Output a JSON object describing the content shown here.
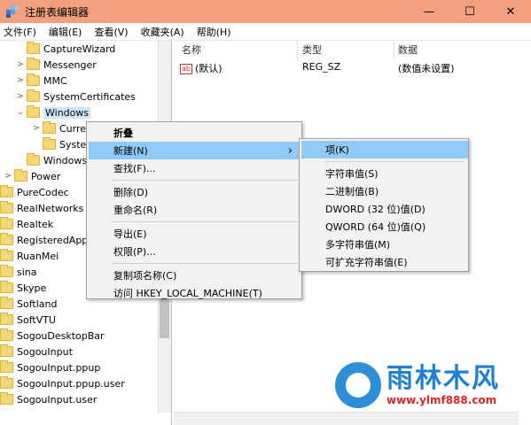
{
  "window": {
    "title": "注册表编辑器",
    "min": "—",
    "max": "☐",
    "close": "✕"
  },
  "menu": [
    "文件(F)",
    "编辑(E)",
    "查看(V)",
    "收藏夹(A)",
    "帮助(H)"
  ],
  "tree": [
    {
      "label": "CaptureWizard",
      "indent": 2,
      "expander": ""
    },
    {
      "label": "Messenger",
      "indent": 2,
      "expander": ">"
    },
    {
      "label": "MMC",
      "indent": 2,
      "expander": ">"
    },
    {
      "label": "SystemCertificates",
      "indent": 2,
      "expander": ">"
    },
    {
      "label": "Windows",
      "indent": 2,
      "expander": "v",
      "selected": true
    },
    {
      "label": "Curre",
      "indent": 3,
      "expander": ">"
    },
    {
      "label": "Syster",
      "indent": 3,
      "expander": ""
    },
    {
      "label": "Windows",
      "indent": 2,
      "expander": ""
    },
    {
      "label": "Power",
      "indent": 1,
      "expander": ">"
    },
    {
      "label": "PureCodec",
      "indent": 0,
      "expander": ""
    },
    {
      "label": "RealNetworks",
      "indent": 0,
      "expander": ""
    },
    {
      "label": "Realtek",
      "indent": 0,
      "expander": ""
    },
    {
      "label": "RegisteredAppl",
      "indent": 0,
      "expander": ""
    },
    {
      "label": "RuanMei",
      "indent": 0,
      "expander": ""
    },
    {
      "label": "sina",
      "indent": 0,
      "expander": ""
    },
    {
      "label": "Skype",
      "indent": 0,
      "expander": ""
    },
    {
      "label": "Softland",
      "indent": 0,
      "expander": ""
    },
    {
      "label": "SoftVTU",
      "indent": 0,
      "expander": ""
    },
    {
      "label": "SogouDesktopBar",
      "indent": 0,
      "expander": ""
    },
    {
      "label": "SogouInput",
      "indent": 0,
      "expander": ""
    },
    {
      "label": "SogouInput.ppup",
      "indent": 0,
      "expander": ""
    },
    {
      "label": "SogouInput.ppup.user",
      "indent": 0,
      "expander": ""
    },
    {
      "label": "SogouInput.user",
      "indent": 0,
      "expander": ""
    }
  ],
  "columns": {
    "name": "名称",
    "type": "类型",
    "data": "数据"
  },
  "row": {
    "icon": "ab",
    "name": "(默认)",
    "type": "REG_SZ",
    "data": "(数值未设置)"
  },
  "context_menu": {
    "items": [
      {
        "label": "折叠",
        "bold": true
      },
      {
        "label": "新建(N)",
        "arrow": "›",
        "highlighted": true
      },
      {
        "label": "查找(F)..."
      },
      {
        "sep": true
      },
      {
        "label": "删除(D)"
      },
      {
        "label": "重命名(R)"
      },
      {
        "sep": true
      },
      {
        "label": "导出(E)"
      },
      {
        "label": "权限(P)..."
      },
      {
        "sep": true
      },
      {
        "label": "复制项名称(C)"
      },
      {
        "label": "访问 HKEY_LOCAL_MACHINE(T)"
      }
    ]
  },
  "submenu": {
    "items": [
      {
        "label": "项(K)",
        "highlighted": true
      },
      {
        "sep": true
      },
      {
        "label": "字符串值(S)"
      },
      {
        "label": "二进制值(B)"
      },
      {
        "label": "DWORD (32 位)值(D)"
      },
      {
        "label": "QWORD (64 位)值(Q)"
      },
      {
        "label": "多字符串值(M)"
      },
      {
        "label": "可扩充字符串值(E)"
      }
    ]
  },
  "watermark": {
    "title": "雨林木风",
    "url": "www.ylmf888.com"
  },
  "colors": {
    "titlebar": "#f2a07f",
    "highlight": "#91c9f7",
    "folder": "#f7d774"
  }
}
